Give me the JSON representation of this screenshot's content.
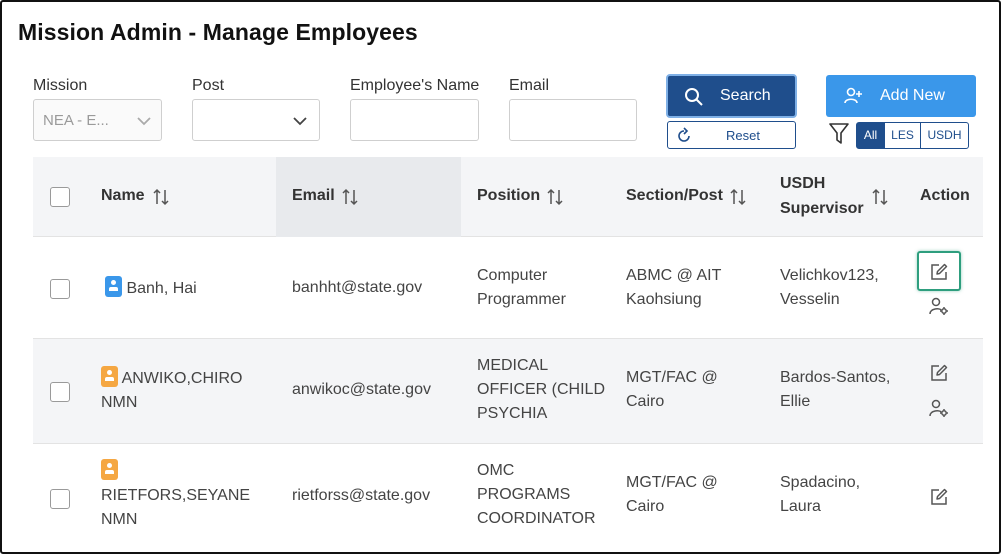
{
  "page": {
    "title": "Mission Admin - Manage Employees"
  },
  "filters": {
    "mission": {
      "label": "Mission",
      "value": "NEA - E..."
    },
    "post": {
      "label": "Post",
      "value": ""
    },
    "employee_name": {
      "label": "Employee's Name",
      "value": ""
    },
    "email": {
      "label": "Email",
      "value": ""
    }
  },
  "actions": {
    "search_label": "Search",
    "reset_label": "Reset",
    "add_new_label": "Add New"
  },
  "type_filter": {
    "options": [
      "All",
      "LES",
      "USDH"
    ],
    "selected": "All"
  },
  "table": {
    "columns": {
      "name": "Name",
      "email": "Email",
      "position": "Position",
      "section_post": "Section/Post",
      "usdh_supervisor_1": "USDH",
      "usdh_supervisor_2": "Supervisor",
      "action": "Action"
    },
    "sorted_column": "Email",
    "rows": [
      {
        "name_lines": [
          "Banh, Hai"
        ],
        "badge": "blue",
        "email": "banhht@state.gov",
        "position_lines": [
          "Computer",
          "Programmer"
        ],
        "section_lines": [
          "ABMC @ AIT",
          "Kaohsiung"
        ],
        "supervisor_lines": [
          "Velichkov123,",
          "Vesselin"
        ]
      },
      {
        "name_lines": [
          "ANWIKO,CHIRO",
          "NMN"
        ],
        "badge": "orange",
        "email": "anwikoc@state.gov",
        "position_lines": [
          "MEDICAL",
          "OFFICER (CHILD",
          "PSYCHIA"
        ],
        "section_lines": [
          "MGT/FAC @",
          "Cairo"
        ],
        "supervisor_lines": [
          "Bardos-Santos,",
          "Ellie"
        ]
      },
      {
        "name_lines": [
          "RIETFORS,SEYANE",
          "NMN"
        ],
        "badge": "orange",
        "email": "rietforss@state.gov",
        "position_lines": [
          "OMC",
          "PROGRAMS",
          "COORDINATOR"
        ],
        "section_lines": [
          "MGT/FAC @",
          "Cairo"
        ],
        "supervisor_lines": [
          "Spadacino,",
          "Laura"
        ]
      }
    ]
  },
  "colors": {
    "primary": "#1f4e8c",
    "accent": "#3a97ea",
    "les_badge": "#f5a742",
    "focus": "#2e9e7e"
  }
}
